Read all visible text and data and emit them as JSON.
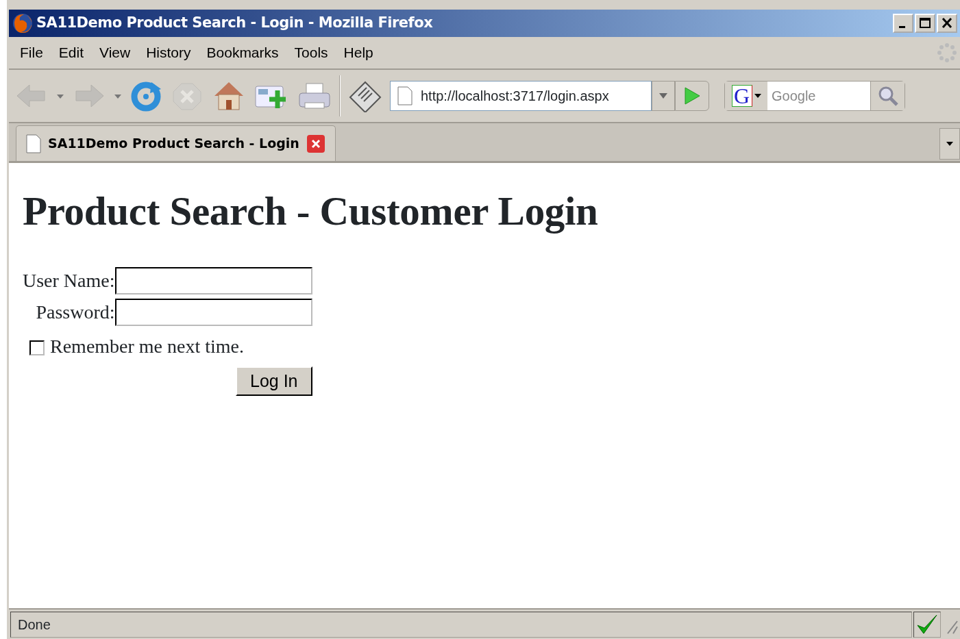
{
  "window": {
    "title": "SA11Demo Product Search - Login - Mozilla Firefox"
  },
  "menu": [
    {
      "label": "File"
    },
    {
      "label": "Edit"
    },
    {
      "label": "View"
    },
    {
      "label": "History"
    },
    {
      "label": "Bookmarks"
    },
    {
      "label": "Tools"
    },
    {
      "label": "Help"
    }
  ],
  "toolbar": {
    "back_disabled": true,
    "forward_disabled": true,
    "stop_disabled": true,
    "url": "http://localhost:3717/login.aspx",
    "search": {
      "engine": "G",
      "placeholder": "Google"
    }
  },
  "tabs": [
    {
      "label": "SA11Demo Product Search - Login",
      "selected": true
    }
  ],
  "page": {
    "heading": "Product Search - Customer Login",
    "fields": [
      {
        "label": "User Name:"
      },
      {
        "label": "Password:"
      }
    ],
    "remember": {
      "label": "Remember me next time.",
      "checked": false
    },
    "button": "Log In"
  },
  "status_bar": {
    "text": "Done",
    "secure_ok": true
  }
}
